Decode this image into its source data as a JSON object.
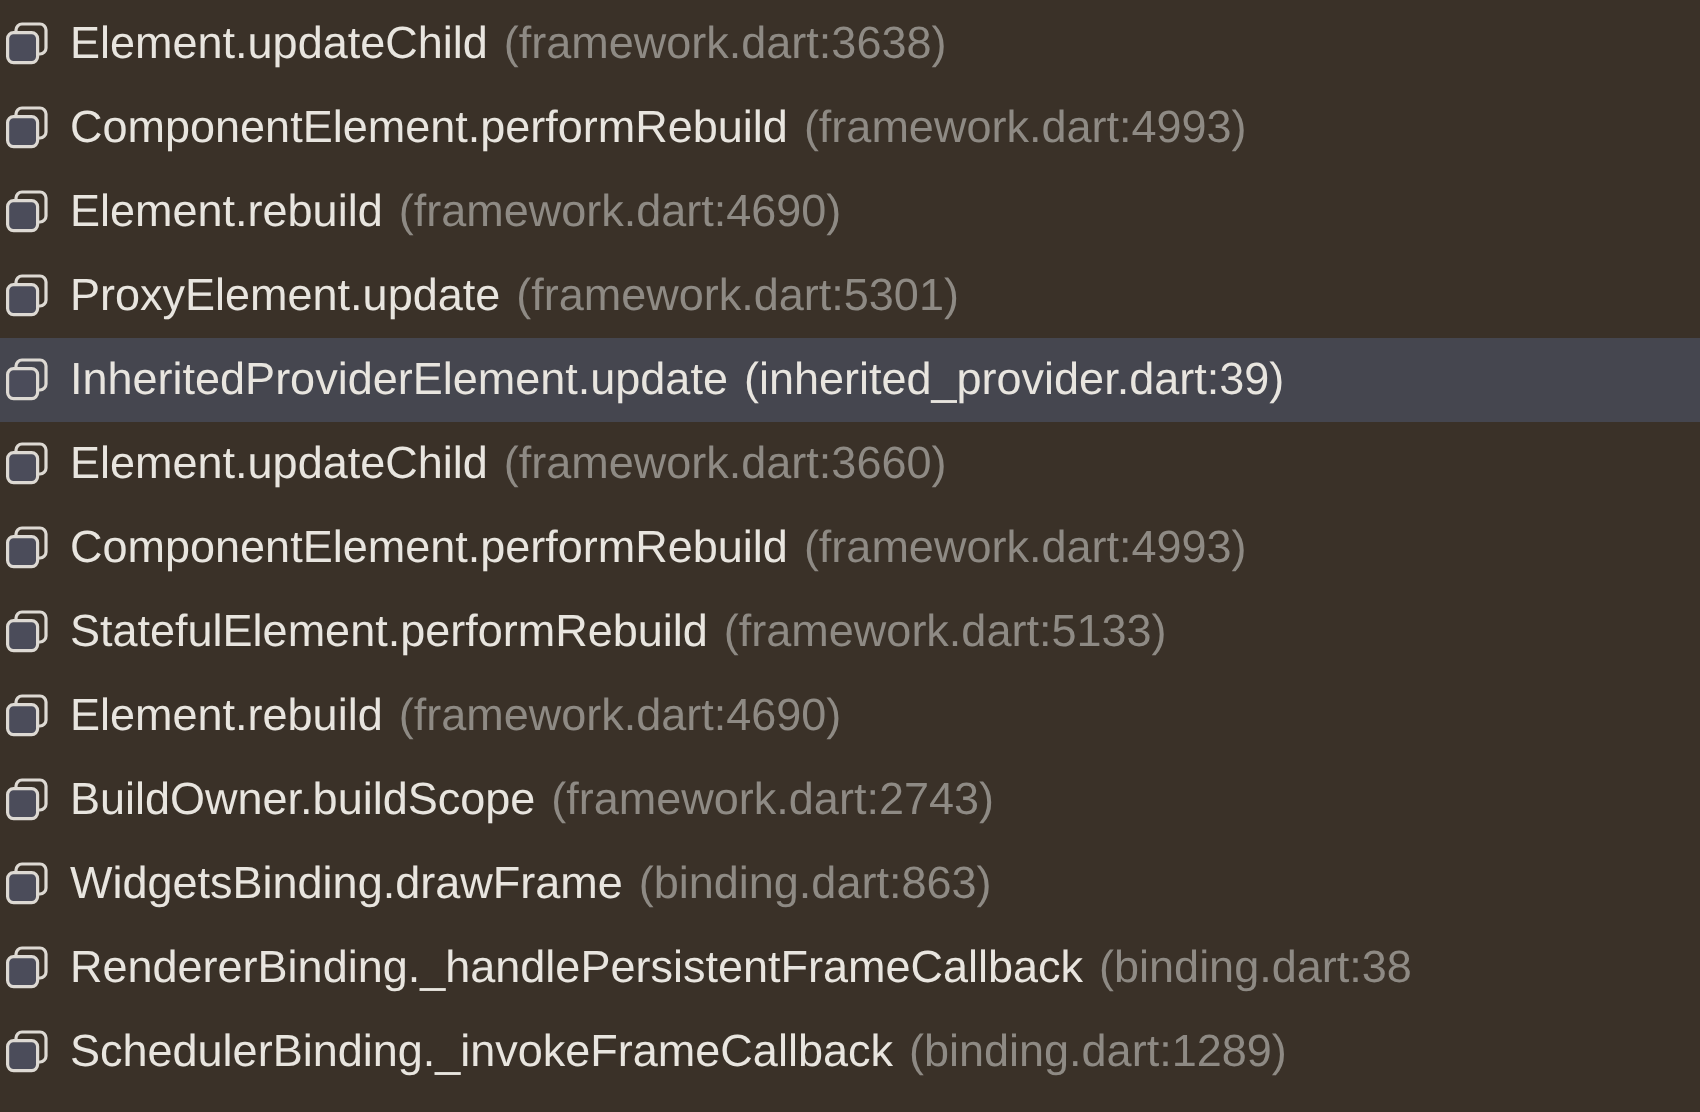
{
  "frames": [
    {
      "method": "Element.updateChild",
      "location": "(framework.dart:3638)",
      "selected": false
    },
    {
      "method": "ComponentElement.performRebuild",
      "location": "(framework.dart:4993)",
      "selected": false
    },
    {
      "method": "Element.rebuild",
      "location": "(framework.dart:4690)",
      "selected": false
    },
    {
      "method": "ProxyElement.update",
      "location": "(framework.dart:5301)",
      "selected": false
    },
    {
      "method": "InheritedProviderElement.update",
      "location": "(inherited_provider.dart:39)",
      "selected": true
    },
    {
      "method": "Element.updateChild",
      "location": "(framework.dart:3660)",
      "selected": false
    },
    {
      "method": "ComponentElement.performRebuild",
      "location": "(framework.dart:4993)",
      "selected": false
    },
    {
      "method": "StatefulElement.performRebuild",
      "location": "(framework.dart:5133)",
      "selected": false
    },
    {
      "method": "Element.rebuild",
      "location": "(framework.dart:4690)",
      "selected": false
    },
    {
      "method": "BuildOwner.buildScope",
      "location": "(framework.dart:2743)",
      "selected": false
    },
    {
      "method": "WidgetsBinding.drawFrame",
      "location": "(binding.dart:863)",
      "selected": false
    },
    {
      "method": "RendererBinding._handlePersistentFrameCallback",
      "location": "(binding.dart:38",
      "selected": false
    },
    {
      "method": "SchedulerBinding._invokeFrameCallback",
      "location": "(binding.dart:1289)",
      "selected": false
    }
  ]
}
